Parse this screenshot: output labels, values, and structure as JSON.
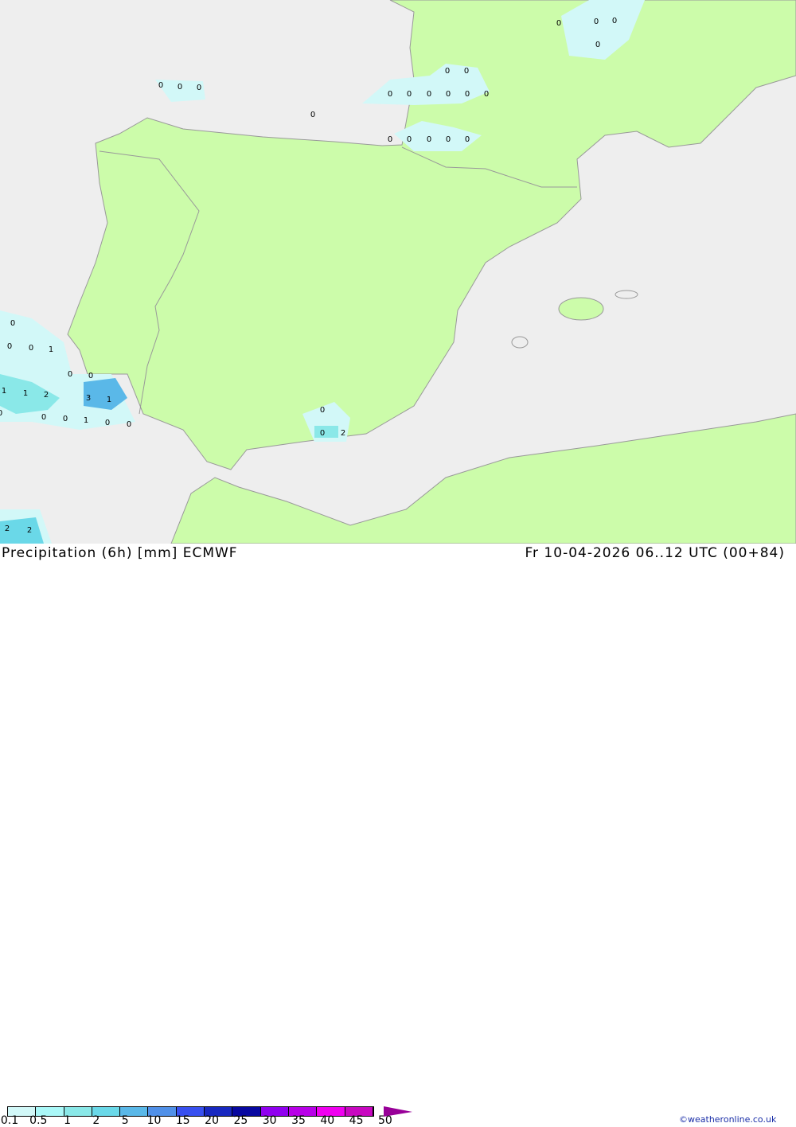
{
  "title": "Precipitation (6h) [mm] ECMWF",
  "datetime": "Fr 10-04-2026 06..12 UTC (00+84)",
  "copyright": "©weatheronline.co.uk",
  "legend": {
    "ticks": [
      "0.1",
      "0.5",
      "1",
      "2",
      "5",
      "10",
      "15",
      "20",
      "25",
      "30",
      "35",
      "40",
      "45",
      "50"
    ],
    "colors": [
      "#d2f8f8",
      "#aaf8f8",
      "#8ae8e8",
      "#6ad8e8",
      "#5ab8e8",
      "#5090e8",
      "#3850f0",
      "#1828c0",
      "#0808a0",
      "#9000f0",
      "#b800e8",
      "#f000f0",
      "#c808c0",
      "#980098"
    ]
  },
  "map": {
    "land_color": "#ccfcaa",
    "sea_color": "#eeeeee",
    "border_color": "#999999"
  },
  "precip_labels": [
    "0",
    "0",
    "0",
    "0",
    "0",
    "0",
    "0",
    "0",
    "0",
    "0",
    "0",
    "0",
    "0",
    "0",
    "0",
    "0",
    "0",
    "0",
    "0",
    "0",
    "0",
    "0",
    "0",
    "0",
    "1",
    "0",
    "0",
    "1",
    "1",
    "2",
    "3",
    "1",
    "0",
    "0",
    "0",
    "1",
    "0",
    "0",
    "0",
    "2",
    "0",
    "2",
    "2"
  ]
}
